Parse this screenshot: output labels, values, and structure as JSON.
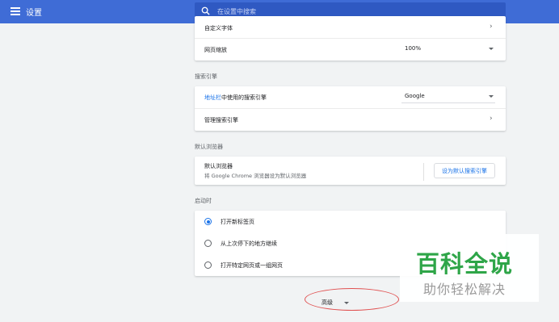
{
  "app": {
    "title": "设置"
  },
  "search": {
    "placeholder": "在设置中搜索",
    "value": ""
  },
  "appearance": {
    "custom_fonts_label": "自定义字体",
    "page_zoom_label": "网页缩放",
    "page_zoom_value": "100%"
  },
  "search_engine": {
    "section_title": "搜索引擎",
    "address_bar_link": "地址栏",
    "address_bar_rest": "中使用的搜索引擎",
    "engine_value": "Google",
    "manage_label": "管理搜索引擎"
  },
  "default_browser": {
    "section_title": "默认浏览器",
    "title": "默认浏览器",
    "description": "将 Google Chrome 浏览器设为默认浏览器",
    "button_label": "设为默认搜索引擎"
  },
  "on_startup": {
    "section_title": "启动时",
    "options": [
      {
        "label": "打开新标签页",
        "selected": true
      },
      {
        "label": "从上次停下的地方继续",
        "selected": false
      },
      {
        "label": "打开特定网页或一组网页",
        "selected": false
      }
    ]
  },
  "advanced": {
    "label": "高级"
  },
  "watermark": {
    "logo_text": "百科全说",
    "tagline": "助你轻松解决"
  },
  "colors": {
    "topbar": "#3f6cd6",
    "accent": "#1a73e8",
    "annotation": "#e05050",
    "watermark_green": "#2ea548"
  }
}
